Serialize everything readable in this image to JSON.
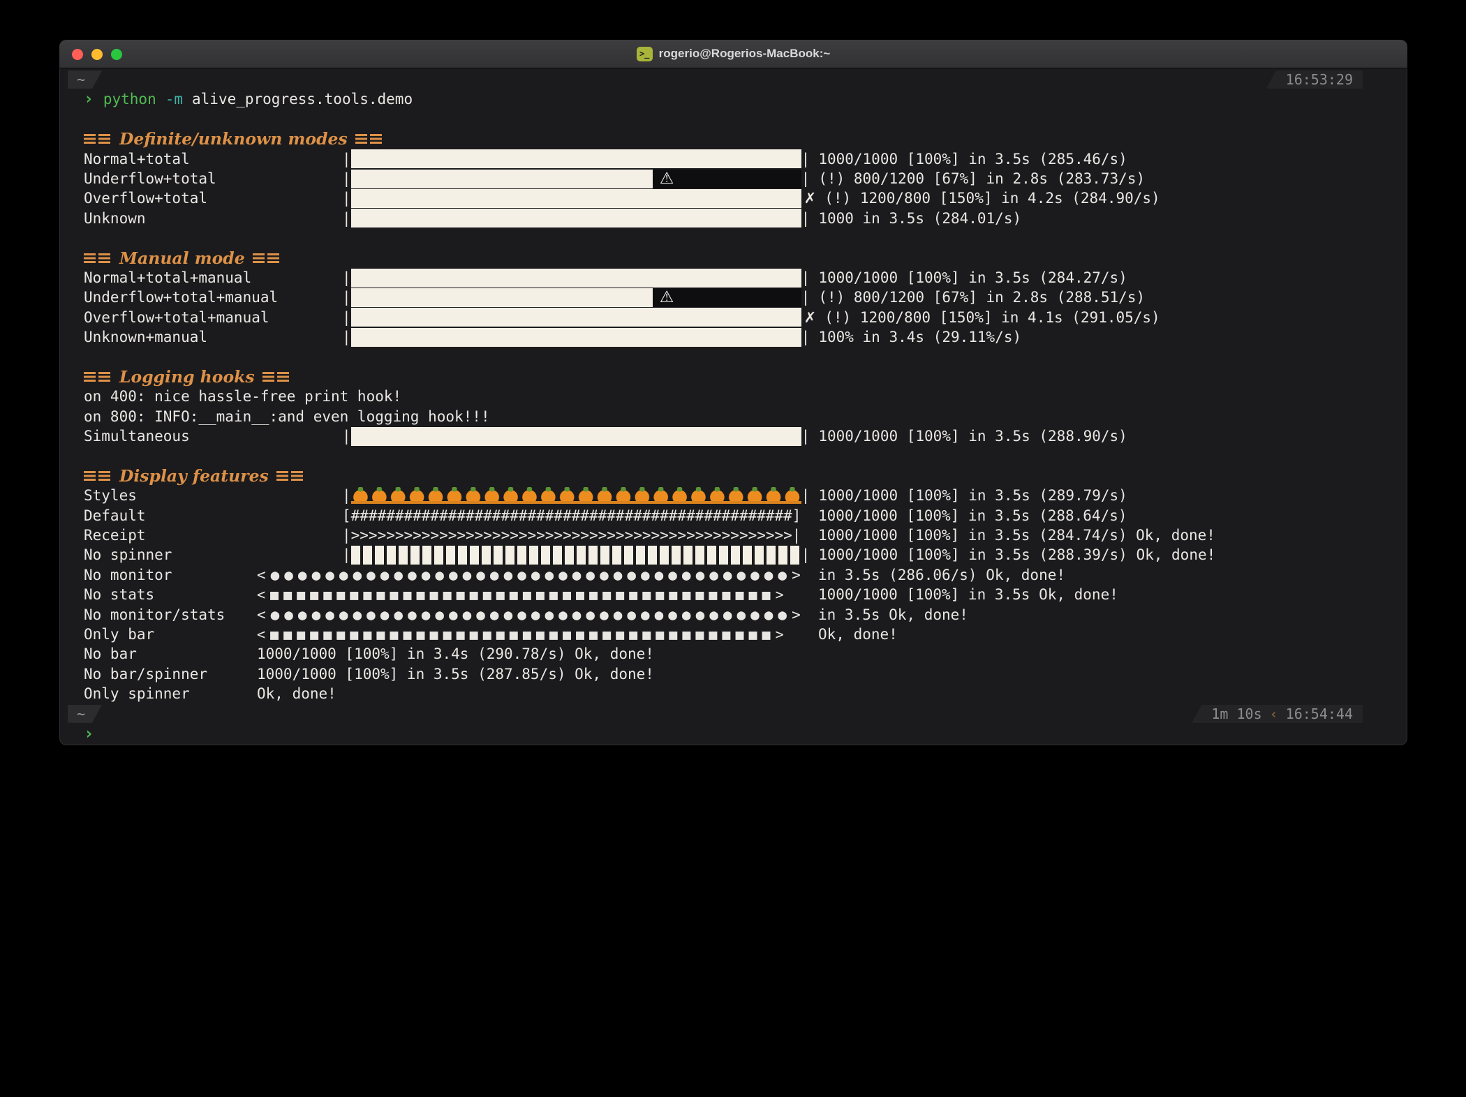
{
  "window": {
    "title": "rogerio@Rogerios-MacBook:~",
    "icon_glyph": ">_",
    "top_tab": "~",
    "top_time": "16:53:29",
    "bottom_tab": "~",
    "bottom_duration": "1m 10s",
    "separator": "‹",
    "bottom_time": "16:54:44",
    "prompt": "›"
  },
  "command": {
    "prompt": "›",
    "program": "python",
    "option": "-m",
    "argument": "alive_progress.tools.demo"
  },
  "glyphs": {
    "pipe": "|",
    "warning": "⚠",
    "cross": "✗",
    "pumpkin": "🎃",
    "block": "█",
    "hash_bar": "[##################################################]",
    "arrow_bar": "|>>>>>>>>>>>>>>>>>>>>>>>>>>>>>>>>>>>>>>>>>>>>>>>>>>|",
    "dots_bar": "<●●●●●●●●●●●●●●●●●●●●●●●●●●●●●●●●●●●●●●>",
    "squares_bar": "<■■■■■■■■■■■■■■■■■■■■■■■■■■■■■■■■■■■■■■>"
  },
  "colors": {
    "terminal_bg": "#1b1b1d",
    "bar_fill": "#f5f0e6",
    "accent_orange": "#dd9147",
    "prompt_green": "#50bb52",
    "option_teal": "#42b3a7",
    "text": "#e9e7e3"
  },
  "sections": [
    {
      "heading": "Definite/unknown modes",
      "rows": [
        {
          "label": "Normal+total",
          "stats": "1000/1000 [100%] in 3.5s (285.46/s)"
        },
        {
          "label": "Underflow+total",
          "stats": "(!) 800/1200 [67%] in 2.8s (283.73/s)"
        },
        {
          "label": "Overflow+total",
          "stats": "(!) 1200/800 [150%] in 4.2s (284.90/s)"
        },
        {
          "label": "Unknown",
          "stats": "1000 in 3.5s (284.01/s)"
        }
      ]
    },
    {
      "heading": "Manual mode",
      "rows": [
        {
          "label": "Normal+total+manual",
          "stats": "1000/1000 [100%] in 3.5s (284.27/s)"
        },
        {
          "label": "Underflow+total+manual",
          "stats": "(!) 800/1200 [67%] in 2.8s (288.51/s)"
        },
        {
          "label": "Overflow+total+manual",
          "stats": "(!) 1200/800 [150%] in 4.1s (291.05/s)"
        },
        {
          "label": "Unknown+manual",
          "stats": "100% in 3.4s (29.11%/s)"
        }
      ]
    },
    {
      "heading": "Logging hooks",
      "logs": [
        "on 400: nice hassle-free print hook!",
        "on 800: INFO:__main__:and even logging hook!!!"
      ],
      "rows": [
        {
          "label": "Simultaneous",
          "stats": "1000/1000 [100%] in 3.5s (288.90/s)"
        }
      ]
    },
    {
      "heading": "Display features",
      "rows": [
        {
          "label": "Styles",
          "stats": "1000/1000 [100%] in 3.5s (289.79/s)"
        },
        {
          "label": "Default",
          "stats": "1000/1000 [100%] in 3.5s (288.64/s)"
        },
        {
          "label": "Receipt",
          "stats": "1000/1000 [100%] in 3.5s (284.74/s) Ok, done!"
        },
        {
          "label": "No spinner",
          "stats": "1000/1000 [100%] in 3.5s (288.39/s) Ok, done!"
        },
        {
          "label": "No monitor",
          "stats": "in 3.5s (286.06/s) Ok, done!"
        },
        {
          "label": "No stats",
          "stats": "1000/1000 [100%] in 3.5s Ok, done!"
        },
        {
          "label": "No monitor/stats",
          "stats": "in 3.5s Ok, done!"
        },
        {
          "label": "Only bar",
          "stats": "Ok, done!"
        },
        {
          "label": "No bar",
          "stats": "1000/1000 [100%] in 3.4s (290.78/s) Ok, done!"
        },
        {
          "label": "No bar/spinner",
          "stats": "1000/1000 [100%] in 3.5s (287.85/s) Ok, done!"
        },
        {
          "label": "Only spinner",
          "stats": "Ok, done!"
        }
      ]
    }
  ]
}
